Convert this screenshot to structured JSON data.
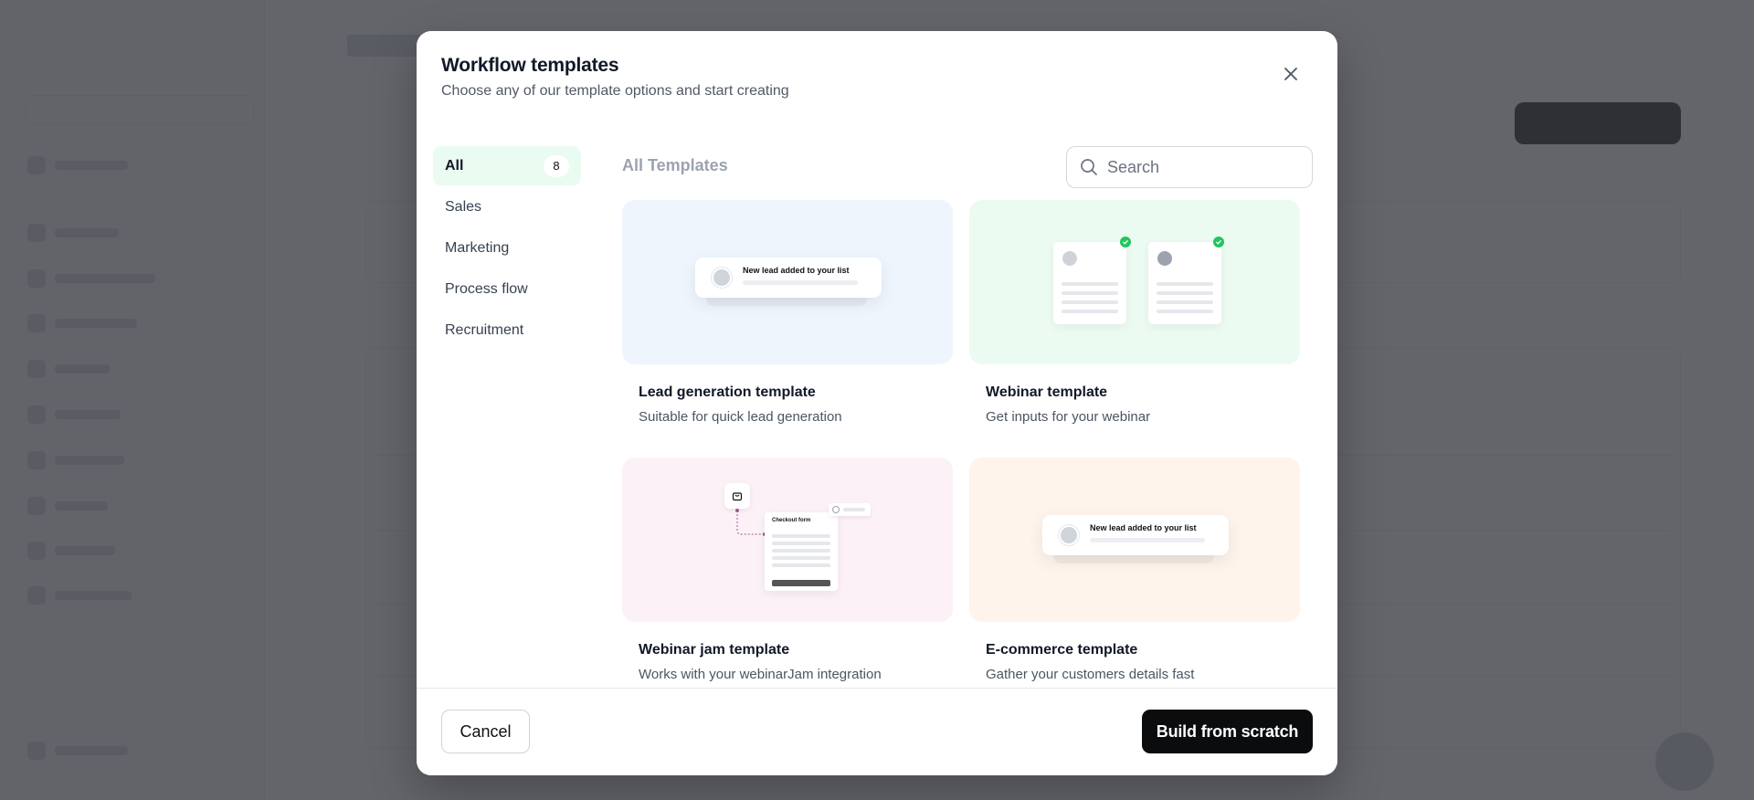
{
  "modal": {
    "title": "Workflow templates",
    "subtitle": "Choose any of our template options and start creating"
  },
  "categories": [
    {
      "label": "All",
      "count": "8",
      "active": true
    },
    {
      "label": "Sales"
    },
    {
      "label": "Marketing"
    },
    {
      "label": "Process flow"
    },
    {
      "label": "Recruitment"
    }
  ],
  "section_title": "All Templates",
  "search": {
    "placeholder": "Search",
    "value": ""
  },
  "templates": [
    {
      "name": "Lead generation template",
      "description": "Suitable for quick lead generation",
      "preview_text": "New lead added to your list",
      "bg": "#eef5fd"
    },
    {
      "name": "Webinar template",
      "description": "Get inputs for your webinar",
      "bg": "#ecfbf1"
    },
    {
      "name": "Webinar jam template",
      "description": "Works with your webinarJam integration",
      "preview_text": "Checkout form",
      "bg": "#fdf1f8"
    },
    {
      "name": "E-commerce template",
      "description": "Gather your customers details fast",
      "preview_text": "New lead added to your list",
      "bg": "#fef4ec"
    }
  ],
  "footer": {
    "cancel_label": "Cancel",
    "build_label": "Build from scratch"
  },
  "colors": {
    "primary": "#0b0c0e",
    "active_category_bg": "#eafbf2",
    "success": "#22c55e"
  }
}
